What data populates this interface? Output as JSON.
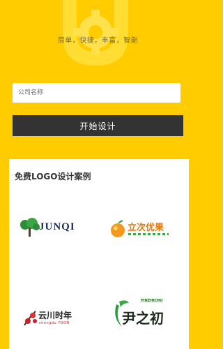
{
  "hero": {
    "slogan": "简单，快捷，丰富，智能"
  },
  "form": {
    "company_placeholder": "公司名称",
    "start_label": "开始设计"
  },
  "cases": {
    "title": "免费LOGO设计案例",
    "logos": [
      {
        "text": "JUNQI"
      },
      {
        "text": "立次优果",
        "subtext": ""
      },
      {
        "text": "云川时年",
        "subtext": "chengdu YOON"
      },
      {
        "text": "尹之初",
        "subtext": "YINZHICHU"
      }
    ]
  },
  "colors": {
    "background": "#ffcc00",
    "button": "#333333",
    "card": "#ffffff"
  }
}
